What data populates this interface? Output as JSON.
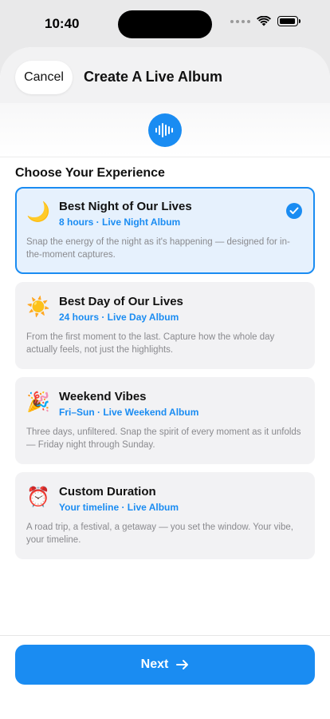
{
  "status_bar": {
    "time": "10:40"
  },
  "header": {
    "cancel_label": "Cancel",
    "title": "Create A Live Album",
    "logo_icon": "sound-wave-icon"
  },
  "section_title": "Choose Your Experience",
  "options": [
    {
      "emoji": "🌙",
      "title": "Best Night of Our Lives",
      "subtitle": "8 hours · Live Night Album",
      "description": "Snap the energy of the night as it's happening — designed for in-the-moment captures.",
      "selected": true
    },
    {
      "emoji": "☀️",
      "title": "Best Day of Our Lives",
      "subtitle": "24 hours · Live Day Album",
      "description": "From the first moment to the last. Capture how the whole day actually feels, not just the highlights.",
      "selected": false
    },
    {
      "emoji": "🎉",
      "title": "Weekend Vibes",
      "subtitle": "Fri–Sun · Live Weekend Album",
      "description": "Three days, unfiltered. Snap the spirit of every moment as it unfolds — Friday night through Sunday.",
      "selected": false
    },
    {
      "emoji": "⏰",
      "title": "Custom Duration",
      "subtitle": "Your timeline · Live Album",
      "description": "A road trip, a festival, a getaway — you set the window. Your vibe, your timeline.",
      "selected": false
    }
  ],
  "footer": {
    "next_label": "Next",
    "next_icon": "arrow-right-icon"
  },
  "colors": {
    "accent": "#1a8cf2",
    "selected_bg": "#e6f1fd",
    "card_bg": "#f2f2f4"
  }
}
